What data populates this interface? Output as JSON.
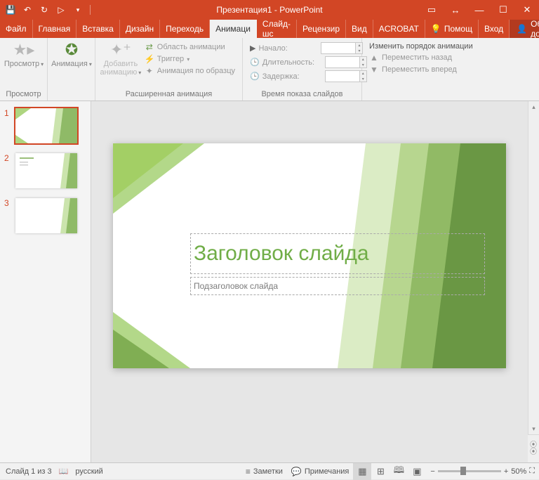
{
  "title": "Презентация1 - PowerPoint",
  "tabs": {
    "file": "Файл",
    "home": "Главная",
    "insert": "Вставка",
    "design": "Дизайн",
    "transitions": "Переходь",
    "animations": "Анимаци",
    "slideshow": "Слайд-шс",
    "review": "Рецензир",
    "view": "Вид",
    "acrobat": "ACROBAT",
    "tell": "Помощ",
    "signin": "Вход",
    "share": "Общий доступ"
  },
  "ribbon": {
    "preview_big": "Просмотр",
    "preview_grp": "Просмотр",
    "anim_big": "Анимация",
    "add_anim": "Добавить\nанимацию",
    "adv_grp": "Расширенная анимация",
    "anim_pane": "Область анимации",
    "trigger": "Триггер",
    "painter": "Анимация по образцу",
    "start": "Начало:",
    "duration": "Длительность:",
    "delay": "Задержка:",
    "timing_grp": "Время показа слайдов",
    "reorder": "Изменить порядок анимации",
    "move_earlier": "Переместить назад",
    "move_later": "Переместить вперед"
  },
  "thumbs": [
    "1",
    "2",
    "3"
  ],
  "slide": {
    "title": "Заголовок слайда",
    "subtitle": "Подзаголовок слайда"
  },
  "status": {
    "slide": "Слайд 1 из 3",
    "lang": "русский",
    "notes": "Заметки",
    "comments": "Примечания",
    "zoom": "50%"
  }
}
